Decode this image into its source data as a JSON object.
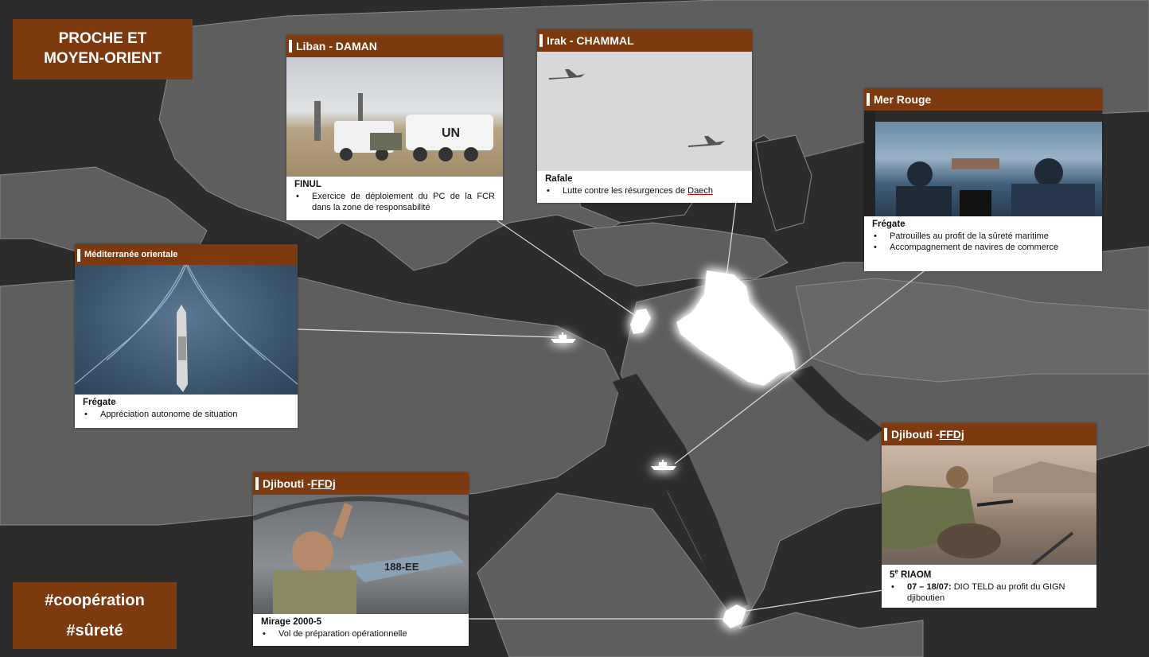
{
  "title": {
    "line1": "PROCHE ET",
    "line2": "MOYEN-ORIENT"
  },
  "hashtags": {
    "tag1": "#coopération",
    "tag2": "#sûreté"
  },
  "colors": {
    "accent": "#7c3a0e",
    "land": "#5e5e5e",
    "sea": "#2c2c2c",
    "highlight": "#ffffff",
    "glow": "#e8752a"
  },
  "cards": {
    "liban": {
      "title": "Liban - DAMAN",
      "subtitle": "FINUL",
      "items": [
        "Exercice de déploiement du PC de la FCR dans la zone de responsabilité"
      ],
      "photo_icon": "un-armored-vehicles-photo"
    },
    "irak": {
      "title": "Irak - CHAMMAL",
      "subtitle": "Rafale",
      "item_text": "Lutte contre les résurgences de ",
      "item_word": "Daech",
      "photo_icon": "fighter-jets-photo"
    },
    "merrouge": {
      "title": "Mer Rouge",
      "subtitle": "Frégate",
      "items": [
        "Patrouilles au profit de la sûreté maritime",
        "Accompagnement de navires de commerce"
      ],
      "photo_icon": "marine-lookouts-photo"
    },
    "med": {
      "title": "Méditerranée orientale",
      "subtitle": "Frégate",
      "items": [
        "Appréciation autonome de situation"
      ],
      "photo_icon": "frigate-wake-photo"
    },
    "djib1": {
      "title_a": "Djibouti - ",
      "title_b": "FFDj",
      "subtitle": "Mirage 2000-5",
      "items": [
        "Vol de préparation opérationnelle"
      ],
      "photo_icon": "mirage-pilot-photo"
    },
    "djib2": {
      "title_a": "Djibouti - ",
      "title_b": "FFDj",
      "subtitle_a": "5",
      "subtitle_sup": "e",
      "subtitle_b": " RIAOM",
      "item_bold": "07  – 18/07:",
      "item_text": " DIO TELD au profit du GIGN djiboutien",
      "photo_icon": "sniper-training-photo"
    }
  }
}
